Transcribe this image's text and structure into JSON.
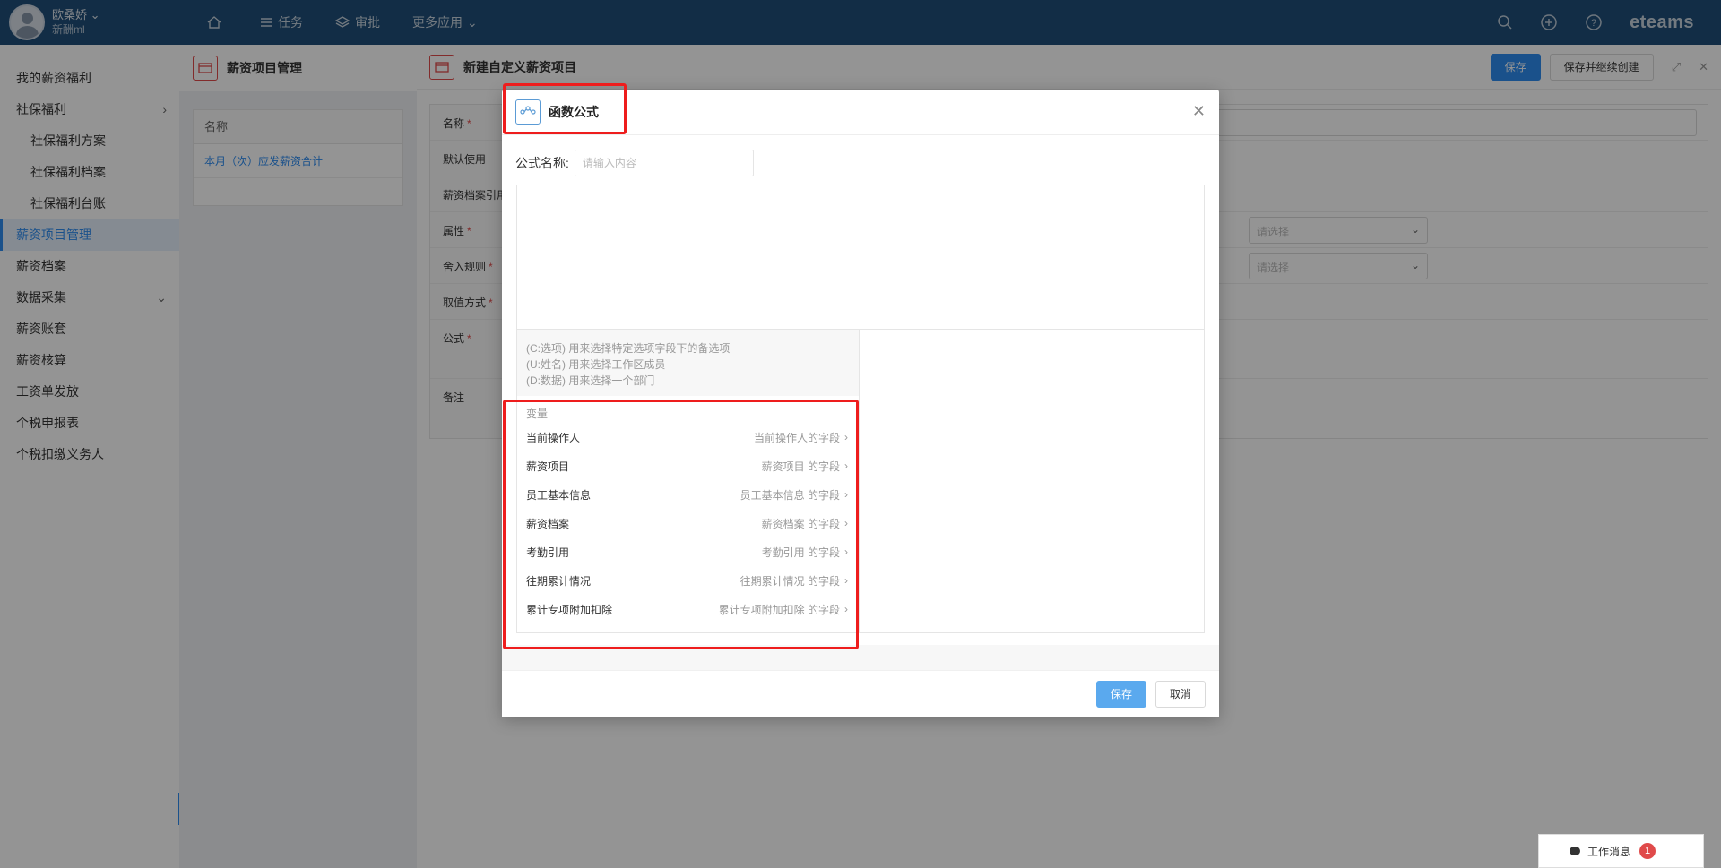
{
  "user": {
    "name": "欧桑娇",
    "sub": "新酬ml"
  },
  "topnav": {
    "task": "任务",
    "approve": "审批",
    "more": "更多应用"
  },
  "brand": "eteams",
  "sidebar": {
    "items": [
      {
        "label": "我的薪资福利"
      },
      {
        "label": "社保福利"
      },
      {
        "label": "社保福利方案"
      },
      {
        "label": "社保福利档案"
      },
      {
        "label": "社保福利台账"
      },
      {
        "label": "薪资项目管理"
      },
      {
        "label": "薪资档案"
      },
      {
        "label": "数据采集"
      },
      {
        "label": "薪资账套"
      },
      {
        "label": "薪资核算"
      },
      {
        "label": "工资单发放"
      },
      {
        "label": "个税申报表"
      },
      {
        "label": "个税扣缴义务人"
      }
    ]
  },
  "list": {
    "title": "薪资项目管理",
    "column": "名称",
    "row1": "本月（次）应发薪资合计"
  },
  "drawer": {
    "title": "新建自定义薪资项目",
    "save": "保存",
    "save_continue": "保存并继续创建",
    "fields": {
      "name": "名称",
      "default_use": "默认使用",
      "archive_ref": "薪资档案引用",
      "attribute": "属性",
      "rounding": "舍入规则",
      "value_mode": "取值方式",
      "formula": "公式",
      "remark": "备注"
    },
    "select_placeholder": "请选择"
  },
  "modal": {
    "title": "函数公式",
    "formula_name_label": "公式名称:",
    "formula_name_placeholder": "请输入内容",
    "hints": [
      "(C:选项) 用来选择特定选项字段下的备选项",
      "(U:姓名) 用来选择工作区成员",
      "(D:数据) 用来选择一个部门"
    ],
    "var_title": "变量",
    "variables": [
      {
        "name": "当前操作人",
        "desc": "当前操作人的字段"
      },
      {
        "name": "薪资项目",
        "desc": "薪资项目 的字段"
      },
      {
        "name": "员工基本信息",
        "desc": "员工基本信息 的字段"
      },
      {
        "name": "薪资档案",
        "desc": "薪资档案 的字段"
      },
      {
        "name": "考勤引用",
        "desc": "考勤引用 的字段"
      },
      {
        "name": "往期累计情况",
        "desc": "往期累计情况 的字段"
      },
      {
        "name": "累计专项附加扣除",
        "desc": "累计专项附加扣除 的字段"
      }
    ],
    "save": "保存",
    "cancel": "取消"
  },
  "workmsg": {
    "label": "工作消息",
    "count": "1"
  },
  "colors": {
    "primary": "#2d8cf0",
    "topbar": "#1f4e79",
    "highlight": "#ee1d1d"
  }
}
